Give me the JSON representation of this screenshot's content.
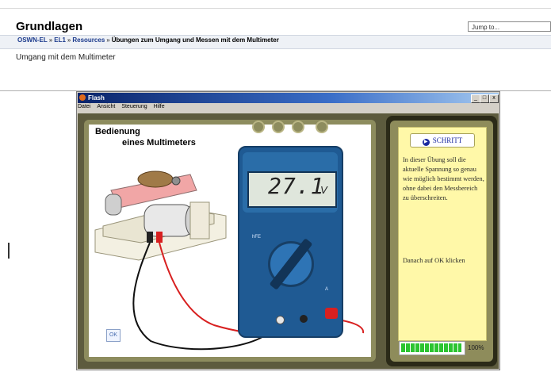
{
  "course": {
    "title": "Grundlagen"
  },
  "jump_to": {
    "value": "Jump to..."
  },
  "breadcrumb": [
    {
      "label": "OSWN-EL"
    },
    {
      "label": "EL1"
    },
    {
      "label": "Resources"
    },
    {
      "label": "Übungen zum Umgang und Messen mit dem Multimeter"
    }
  ],
  "breadcrumb_separator": "»",
  "page": {
    "heading": "Umgang mit dem Multimeter"
  },
  "flash_window": {
    "title": "Flash",
    "buttons": {
      "minimize": "_",
      "maximize": "□",
      "close": "x"
    },
    "menu": [
      "Datei",
      "Ansicht",
      "Steuerung",
      "Hilfe"
    ]
  },
  "simulation": {
    "title_line1": "Bedienung",
    "title_line2": "eines Multimeters",
    "display_value": "27.1",
    "display_unit": "V",
    "ok_label": "OK",
    "step_button": "SCHRITT",
    "instruction_text": "In dieser Übung soll die aktuelle Spannung so genau wie möglich bestimmt werden, ohne dabei den Messbereich zu überschreiten.",
    "instruction_hint": "Danach auf OK klicken",
    "progress_fraction": 1.0,
    "progress_label": "100%",
    "meter_labels": {
      "hfe": "hFE",
      "a": "A"
    }
  },
  "colors": {
    "nav_link": "#1b3a8c",
    "stage_bg": "#5d5b3e",
    "panel": "#8d8c5e",
    "info_box": "#fff8a8",
    "meter_body": "#1f5a93",
    "progress_green": "#2cc430",
    "lead_red": "#d82020",
    "lead_black": "#111111"
  }
}
